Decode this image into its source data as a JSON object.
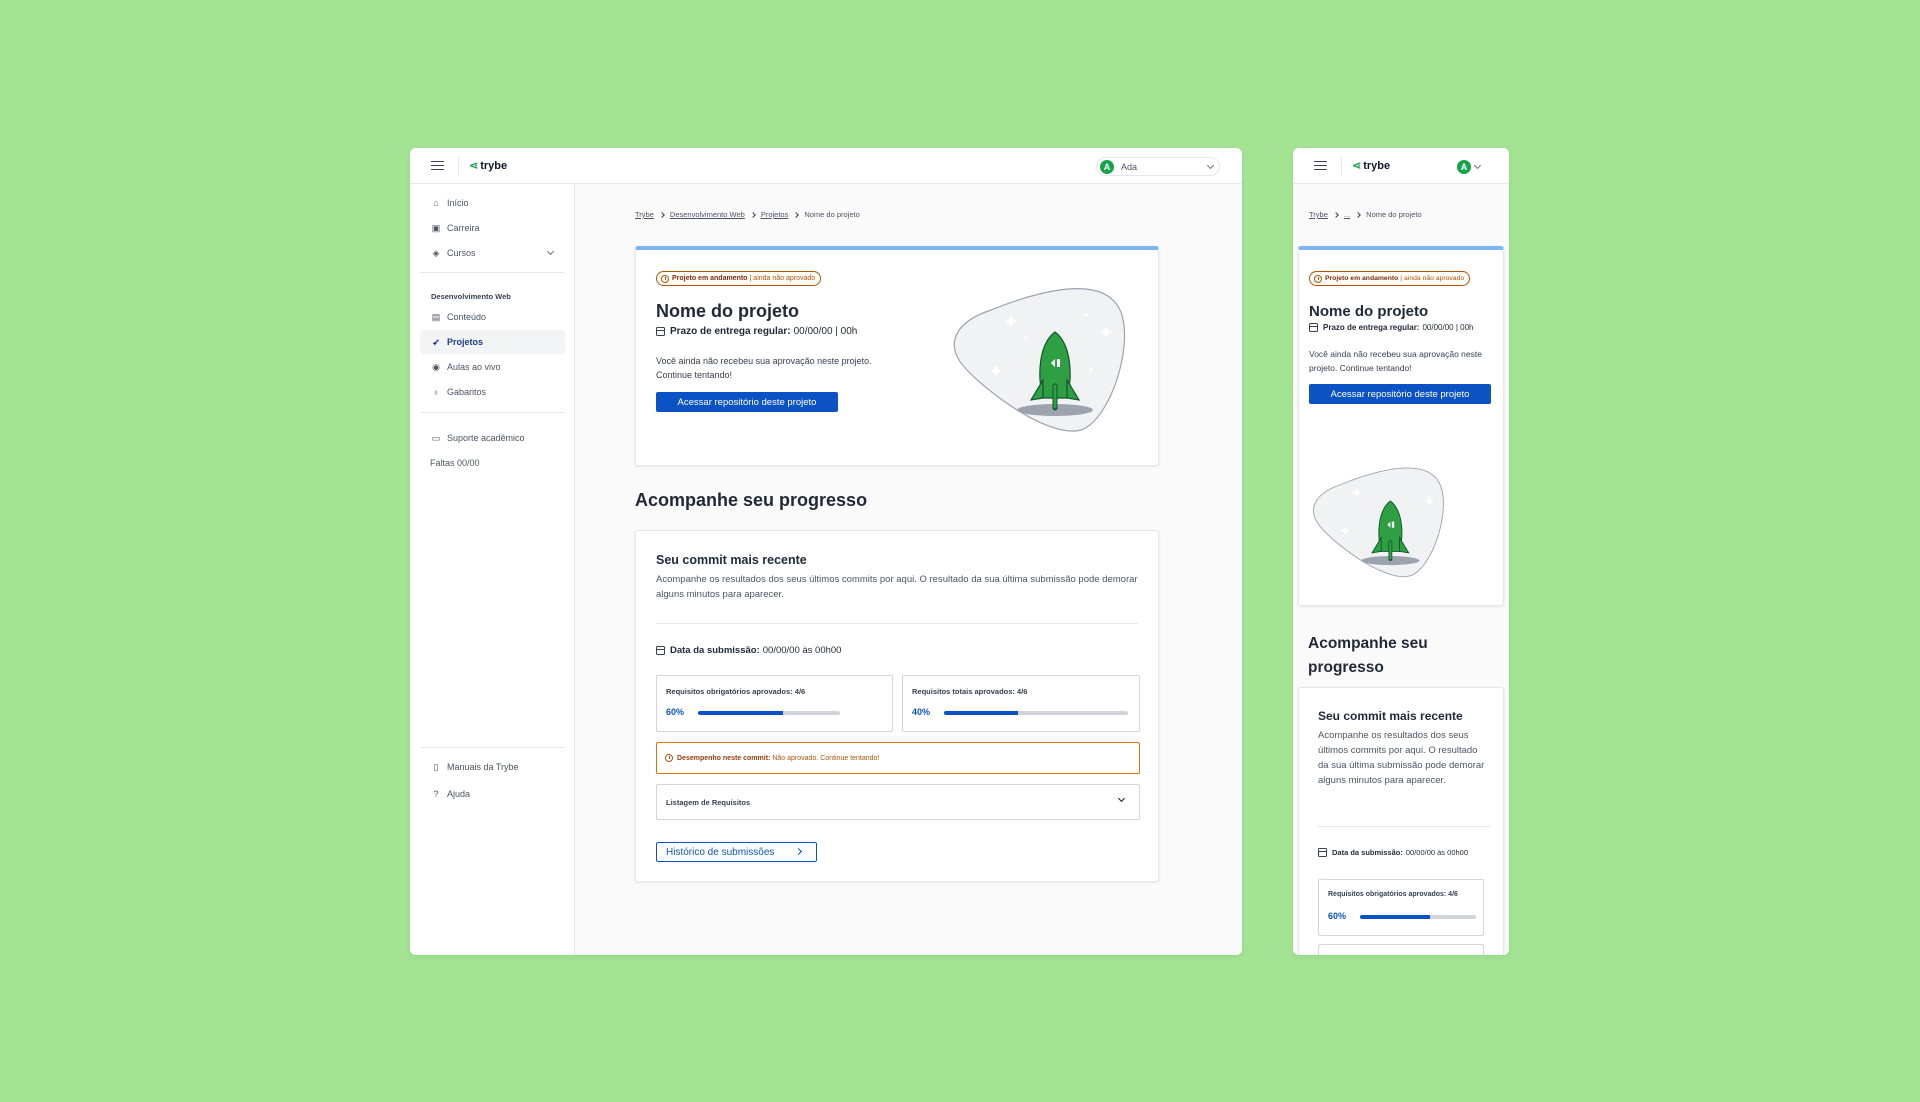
{
  "app": {
    "logo_text": "trybe",
    "logo_mark": "⋖"
  },
  "user": {
    "initial": "A",
    "name": "Ada"
  },
  "sidebar": {
    "items": [
      {
        "label": "Início",
        "icon": "home-icon"
      },
      {
        "label": "Carreira",
        "icon": "briefcase-icon"
      },
      {
        "label": "Cursos",
        "icon": "graduation-cap-icon"
      }
    ],
    "group_title": "Desenvolvimento Web",
    "group_items": [
      {
        "label": "Conteúdo",
        "icon": "book-icon"
      },
      {
        "label": "Projetos",
        "icon": "rocket-icon",
        "active": true
      },
      {
        "label": "Aulas ao vivo",
        "icon": "play-circle-icon"
      },
      {
        "label": "Gabaritos",
        "icon": "lightbulb-icon"
      }
    ],
    "support": {
      "label": "Suporte acadêmico",
      "icon": "chat-icon"
    },
    "absences": "Faltas 00/00",
    "footer": [
      {
        "label": "Manuais da Trybe",
        "icon": "manual-icon"
      },
      {
        "label": "Ajuda",
        "icon": "help-circle-icon"
      }
    ]
  },
  "breadcrumb": {
    "items": [
      "Trybe",
      "Desenvolvimento Web",
      "Projetos"
    ],
    "current": "Nome do projeto",
    "mobile_ellipsis": "..."
  },
  "project": {
    "status_main": "Projeto em andamento",
    "status_sep": "|",
    "status_sub": "ainda não aprovado",
    "title": "Nome do projeto",
    "deadline_label": "Prazo de entrega regular:",
    "deadline_value": "00/00/00 | 00h",
    "message": "Você ainda não recebeu sua aprovação neste projeto. Continue tentando!",
    "repo_button": "Acessar repositório deste projeto"
  },
  "progress": {
    "section_title": "Acompanhe seu progresso",
    "commit_title": "Seu commit mais recente",
    "commit_desc": "Acompanhe os resultados dos seus últimos commits por aqui. O resultado da sua última submissão pode demorar alguns minutos para aparecer.",
    "submission_label": "Data da submissão:",
    "submission_value": "00/00/00 às 00h00",
    "mandatory": {
      "label": "Requisitos obrigatórios aprovados: 4/6",
      "percent_text": "60%",
      "fraction": 0.6
    },
    "total": {
      "label": "Requisitos totais aprovados: 4/6",
      "percent_text": "40%",
      "fraction": 0.4
    },
    "performance_label": "Desempenho neste commit:",
    "performance_value": "Não aprovado. Continue tentando!",
    "requirements_list": "Listagem de Requisitos",
    "history_button": "Histórico de submissões"
  },
  "colors": {
    "background": "#a3e393",
    "primary": "#0b53c4",
    "brand": "#16a34a",
    "warning": "#b45309",
    "accent_top": "#7eb6f5"
  }
}
